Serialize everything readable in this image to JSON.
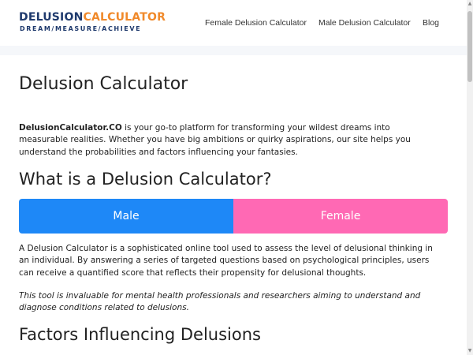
{
  "logo": {
    "part1": "DELUSION",
    "part2": "CALCULATOR",
    "tagline": "DREAM/MEASURE/ACHIEVE"
  },
  "nav": [
    {
      "label": "Female Delusion Calculator"
    },
    {
      "label": "Male Delusion Calculator"
    },
    {
      "label": "Blog"
    }
  ],
  "page": {
    "title": "Delusion Calculator",
    "intro_bold": "DelusionCalculator.CO",
    "intro_rest": " is your go-to platform for transforming your wildest dreams into measurable realities. Whether you have big ambitions or quirky aspirations, our site helps you understand the probabilities and factors influencing your fantasies.",
    "heading_what": "What is a Delusion Calculator?",
    "male_label": "Male",
    "female_label": "Female",
    "para1": "A Delusion Calculator is a sophisticated online tool used to assess the level of delusional thinking in an individual. By answering a series of targeted questions based on psychological principles, users can receive a quantified score that reflects their propensity for delusional thoughts.",
    "para2": "This tool is invaluable for mental health professionals and researchers aiming to understand and diagnose conditions related to delusions.",
    "heading_factors": "Factors Influencing Delusions"
  },
  "colors": {
    "male": "#1e88f7",
    "female": "#ff69b4",
    "logo_navy": "#1f3a6d",
    "logo_orange": "#f0892a"
  }
}
